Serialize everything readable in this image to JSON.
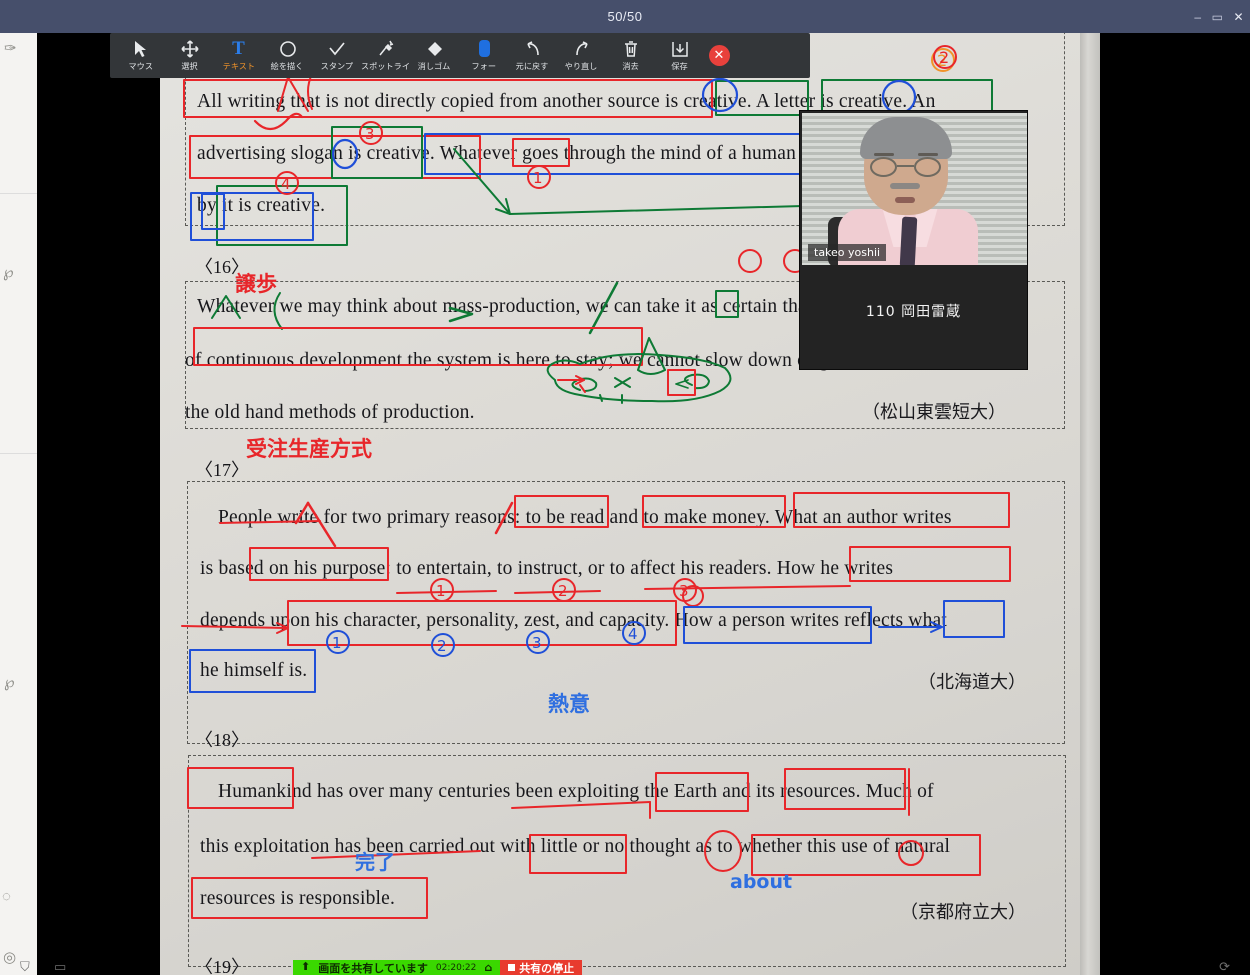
{
  "window": {
    "title": "50/50",
    "minimize": "–",
    "maximize": "▭",
    "close": "✕"
  },
  "toolbar": {
    "tools": [
      {
        "label": "マウス",
        "icon": "cursor-icon",
        "glyph": "➤",
        "active": false
      },
      {
        "label": "選択",
        "icon": "move-select-icon",
        "glyph": "✥",
        "active": false
      },
      {
        "label": "テキスト",
        "icon": "text-icon",
        "glyph": "T",
        "active": true
      },
      {
        "label": "絵を描く",
        "icon": "draw-shape-icon",
        "glyph": "◯",
        "active": false
      },
      {
        "label": "スタンプ",
        "icon": "stamp-check-icon",
        "glyph": "✓",
        "active": false
      },
      {
        "label": "スポットライ",
        "icon": "spotlight-icon",
        "glyph": "✨",
        "active": false
      },
      {
        "label": "消しゴム",
        "icon": "eraser-icon",
        "glyph": "◆",
        "active": false
      },
      {
        "label": "フォー",
        "icon": "format-color-icon",
        "glyph": "▮",
        "active": false
      },
      {
        "label": "元に戻す",
        "icon": "undo-icon",
        "glyph": "↺",
        "active": false
      },
      {
        "label": "やり直し",
        "icon": "redo-icon",
        "glyph": "↻",
        "active": false
      },
      {
        "label": "消去",
        "icon": "trash-icon",
        "glyph": "🗑",
        "active": false
      },
      {
        "label": "保存",
        "icon": "save-icon",
        "glyph": "⤓",
        "active": false
      }
    ],
    "close_label": "✕",
    "active_color": "#f0932a",
    "text_icon_color": "#2b7de9"
  },
  "video": {
    "participant_name": "takeo yoshii",
    "display_label": "110 岡田雷蔵"
  },
  "share": {
    "status_text": "画面を共有しています",
    "timer": "02:20:22",
    "stop_label": "共有の停止",
    "green": "#3ad800",
    "red": "#e83b2e"
  },
  "document": {
    "sections": [
      {
        "number": "",
        "lines": [
          "All writing that is not directly copied from another source is creative.  A letter is creative.  An",
          "advertising slogan is creative.  Whatever goes through the mind of a human being and is set down",
          "by it is creative."
        ],
        "attribution": ""
      },
      {
        "number": "〈16〉",
        "lines": [
          "Whatever we may think about mass-production, we can take it as certain that, in the present state",
          "of continuous development the system is here to stay; we cannot slow down or go back to",
          "the old hand methods of production."
        ],
        "attribution": "（松山東雲短大）"
      },
      {
        "number": "〈17〉",
        "lines": [
          "People write for two primary reasons: to be read and to make money.  What an author writes",
          "is based on his purpose: to entertain, to instruct, or to affect his readers.  How he writes",
          "depends upon his character, personality, zest, and capacity.  How a person writes reflects what",
          "he himself is."
        ],
        "attribution": "（北海道大）"
      },
      {
        "number": "〈18〉",
        "lines": [
          "Humankind has over many centuries been exploiting the Earth and its resources.  Much of",
          "this exploitation has been carried out with little or no thought as to whether this use of natural",
          "resources is responsible."
        ],
        "attribution": "（京都府立大）"
      },
      {
        "number": "〈19〉",
        "lines": [],
        "attribution": ""
      }
    ]
  },
  "annotations": {
    "japanese_notes": [
      {
        "text": "譲歩",
        "color": "#e8262a"
      },
      {
        "text": "受注生産方式",
        "color": "#e8262a"
      },
      {
        "text": "熱意",
        "color": "#2f6fe0"
      },
      {
        "text": "完了",
        "color": "#2f6fe0"
      },
      {
        "text": "about",
        "color": "#2f6fe0"
      }
    ],
    "marks": [
      {
        "text": "S",
        "color": "#e8262a"
      },
      {
        "text": "①",
        "color": "#e8262a"
      },
      {
        "text": "②",
        "color": "#e8262a"
      },
      {
        "text": "③",
        "color": "#e8262a"
      },
      {
        "text": "④",
        "color": "#e8262a"
      },
      {
        "text": "①",
        "color": "#1f4fd8"
      },
      {
        "text": "②",
        "color": "#1f4fd8"
      },
      {
        "text": "③",
        "color": "#1f4fd8"
      },
      {
        "text": "④",
        "color": "#1f4fd8"
      }
    ],
    "colors": {
      "red": "#e8262a",
      "blue": "#1f4fd8",
      "green": "#0e7a35",
      "orange": "#f0932a"
    }
  }
}
